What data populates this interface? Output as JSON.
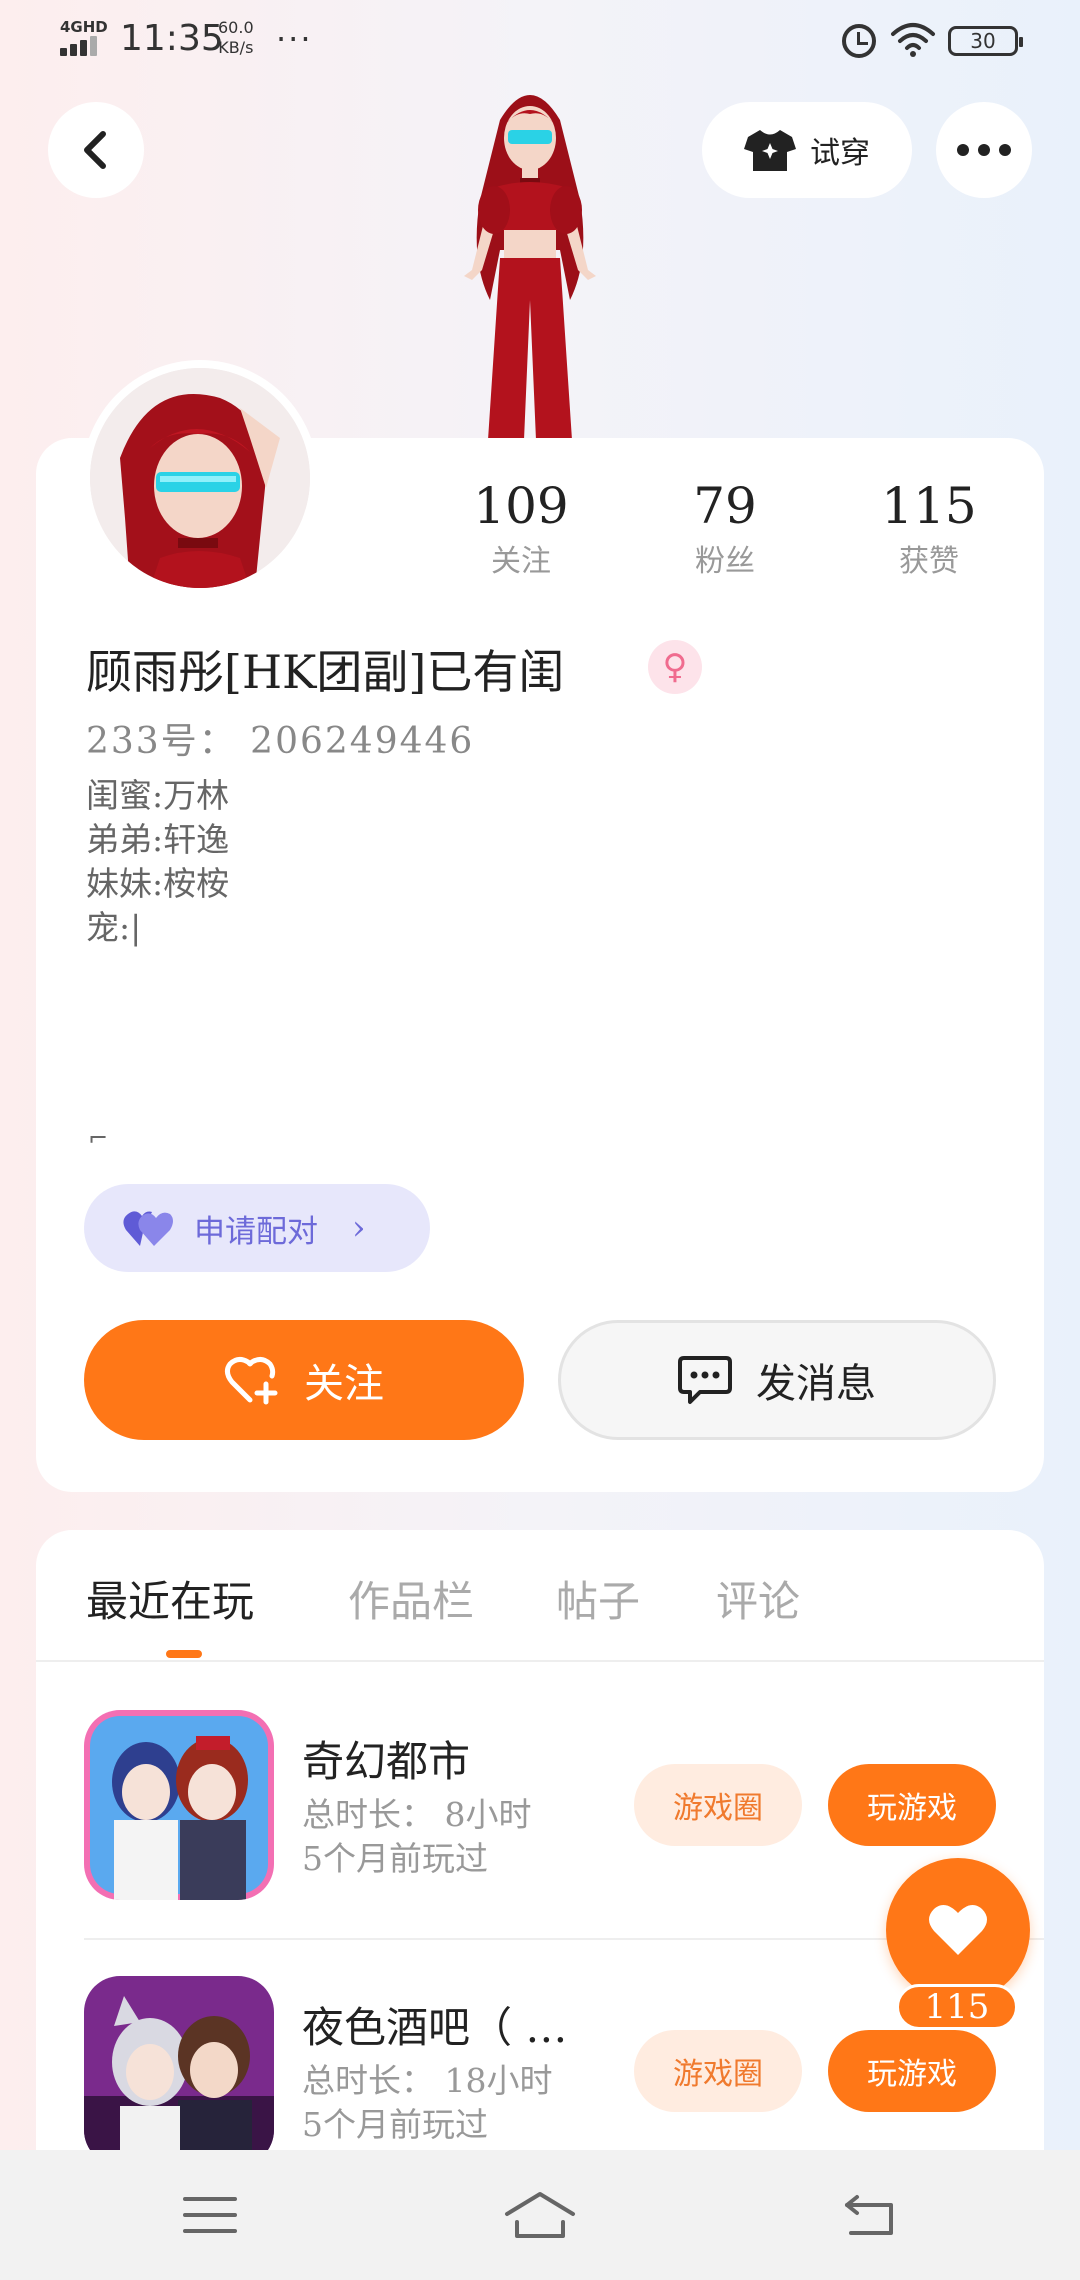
{
  "status_bar": {
    "network": "4GHD",
    "time": "11:35",
    "speed_value": "60.0",
    "speed_unit": "KB/s",
    "more": "···",
    "battery": "30"
  },
  "header": {
    "back_icon": "chevron-left-icon",
    "tryon_label": "试穿",
    "tryon_icon": "tshirt-icon",
    "more_icon": "more-dots-icon"
  },
  "profile": {
    "stats": [
      {
        "value": "109",
        "label": "关注"
      },
      {
        "value": "79",
        "label": "粉丝"
      },
      {
        "value": "115",
        "label": "获赞"
      }
    ],
    "name": "顾雨彤[HK团副]已有闺",
    "gender_symbol": "♀",
    "uid_label": "233号：",
    "uid": "206249446",
    "bio_lines": [
      "闺蜜:万林",
      "弟弟:轩逸",
      "妹妹:桉桉",
      "宠:|"
    ],
    "bio_tail": "⌐",
    "pair_label": "申请配对",
    "pair_chevron": "›",
    "follow_label": "关注",
    "message_label": "发消息"
  },
  "tabs": [
    {
      "label": "最近在玩",
      "active": true
    },
    {
      "label": "作品栏",
      "active": false
    },
    {
      "label": "帖子",
      "active": false
    },
    {
      "label": "评论",
      "active": false
    }
  ],
  "games": [
    {
      "title": "奇幻都市",
      "duration": "总时长： 8小时",
      "last_played": "5个月前玩过",
      "circle_label": "游戏圈",
      "play_label": "玩游戏"
    },
    {
      "title": "夜色酒吧（ …",
      "duration": "总时长： 18小时",
      "last_played": "5个月前玩过",
      "circle_label": "游戏圈",
      "play_label": "玩游戏"
    }
  ],
  "like_fab": {
    "count": "115"
  },
  "colors": {
    "accent": "#ff7717",
    "pair_bg": "#e7e7fb",
    "pair_text": "#6d6ad9",
    "gender_pink": "#f06c8f",
    "character_red": "#b3121d"
  }
}
